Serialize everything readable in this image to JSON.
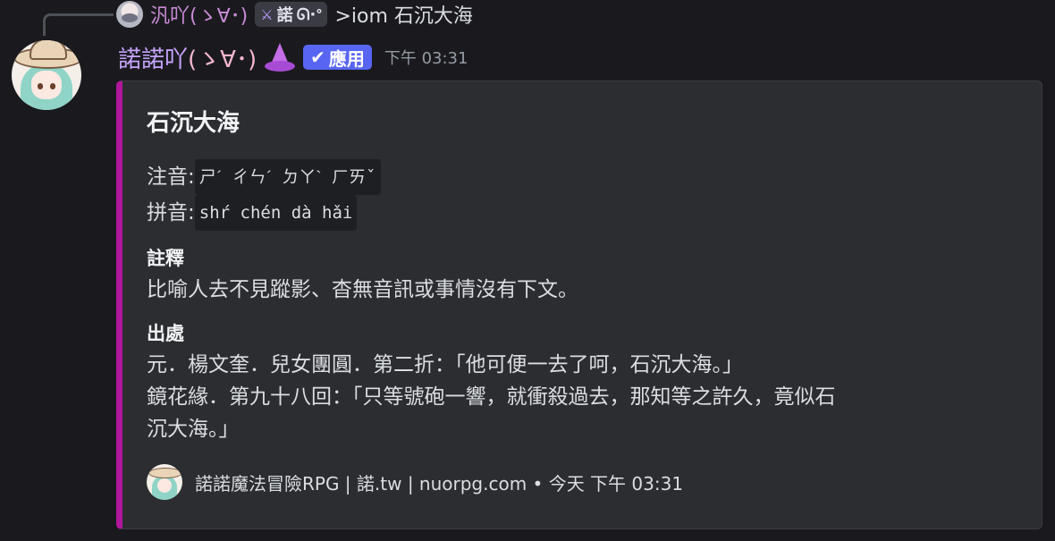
{
  "reply": {
    "username": "汎吖(ゝ∀･)",
    "tag_label": "諾",
    "tag_suffix": "ᘏ·ᐤ",
    "content": ">iom 石沉大海"
  },
  "message": {
    "username_main": "諾諾吖",
    "username_kao": "(ゝ∀･)",
    "emoji_icon": "wizard-hat-icon",
    "app_badge_label": "應用",
    "timestamp": "下午 03:31"
  },
  "embed": {
    "accent_color": "#b0179a",
    "title": "石沉大海",
    "zhuyin_label": "注音:",
    "zhuyin_value": "ㄕˊ ㄔㄣˊ ㄉㄚˋ ㄏㄞˇ",
    "pinyin_label": "拼音:",
    "pinyin_value": "shŕ chén dà hǎi",
    "fields": [
      {
        "name": "註釋",
        "lines": [
          "比喻人去不見蹤影、杳無音訊或事情沒有下文。"
        ]
      },
      {
        "name": "出處",
        "lines": [
          "元．楊文奎．兒女團圓．第二折：「他可便一去了呵，石沉大海。」",
          "鏡花緣．第九十八回：「只等號砲一響，就衝殺過去，那知等之許久，竟似石",
          "沉大海。」"
        ]
      }
    ],
    "footer_text": "諾諾魔法冒險RPG | 諾.tw | nuorpg.com • 今天 下午 03:31"
  }
}
